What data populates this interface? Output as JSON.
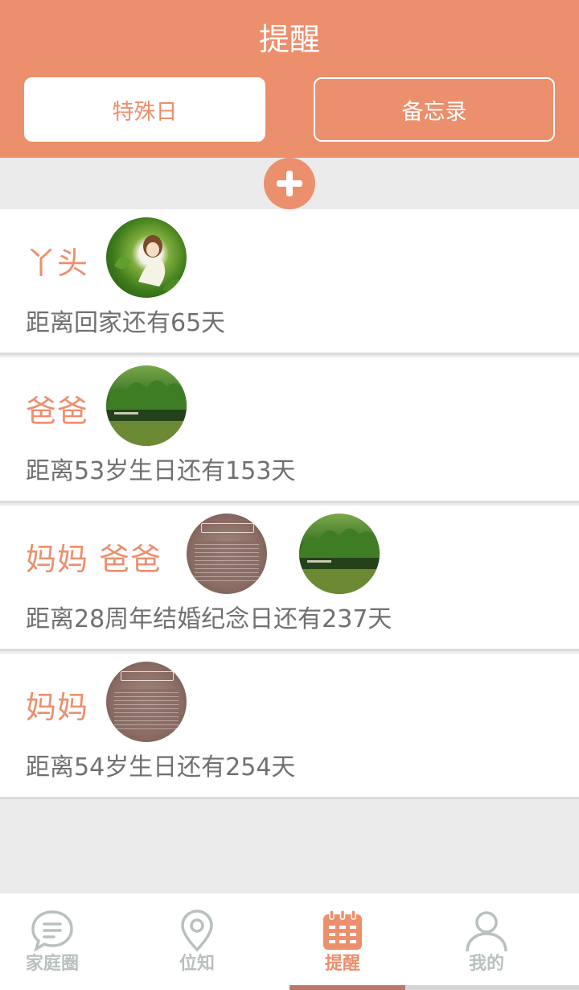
{
  "header": {
    "title": "提醒",
    "segments": [
      {
        "label": "特殊日",
        "active": true
      },
      {
        "label": "备忘录",
        "active": false
      }
    ]
  },
  "colors": {
    "accent": "#ec8f6d",
    "background": "#ebebeb",
    "text_secondary": "#707070",
    "tab_inactive": "#b8c0c0"
  },
  "add_button": {
    "icon": "plus-icon"
  },
  "reminders": [
    {
      "name": "丫头",
      "avatars": [
        "girl-photo"
      ],
      "message": "距离回家还有65天"
    },
    {
      "name": "爸爸",
      "avatars": [
        "lake-photo"
      ],
      "message": "距离53岁生日还有153天"
    },
    {
      "name": "妈妈 爸爸",
      "avatars": [
        "sign-photo",
        "lake-photo"
      ],
      "message": "距离28周年结婚纪念日还有237天"
    },
    {
      "name": "妈妈",
      "avatars": [
        "sign-photo"
      ],
      "message": "距离54岁生日还有254天"
    }
  ],
  "tabbar": {
    "items": [
      {
        "label": "家庭圈",
        "icon": "chat-bubble-icon",
        "active": false
      },
      {
        "label": "位知",
        "icon": "location-pin-icon",
        "active": false
      },
      {
        "label": "提醒",
        "icon": "calendar-icon",
        "active": true
      },
      {
        "label": "我的",
        "icon": "person-icon",
        "active": false
      }
    ]
  }
}
